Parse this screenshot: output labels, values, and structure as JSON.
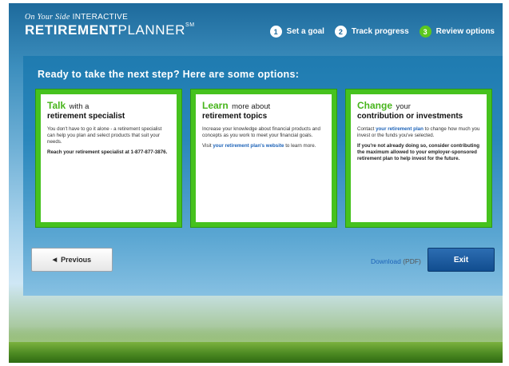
{
  "brand": {
    "tagline_italic": "On Your Side",
    "tagline_rest": "INTERACTIVE",
    "title_bold": "RETIREMENT",
    "title_thin": "PLANNER",
    "trademark": "SM"
  },
  "steps": [
    {
      "num": "1",
      "label": "Set a goal"
    },
    {
      "num": "2",
      "label": "Track progress"
    },
    {
      "num": "3",
      "label": "Review options"
    }
  ],
  "main": {
    "heading": "Ready to take the next step? Here are some options:",
    "cards": [
      {
        "accent": "Talk",
        "rest": "with a",
        "subtitle": "retirement specialist",
        "body": "You don't have to go it alone - a retirement specialist can help you plan and select products that suit your needs.",
        "bold_text": "Reach your retirement specialist at 1-877-877-3876."
      },
      {
        "accent": "Learn",
        "rest": "more about",
        "subtitle": "retirement topics",
        "body": "Increase your knowledge about financial products and concepts as you work to meet your financial goals.",
        "link_pre": "Visit",
        "link_text": "your retirement plan's website",
        "link_post": "to learn more."
      },
      {
        "accent": "Change",
        "rest": "your",
        "subtitle": "contribution or investments",
        "body_pre": "Contact",
        "link_text": "your retirement plan",
        "body_post": "to change how much you invest or the funds you've selected.",
        "bold_text": "If you're not already doing so, consider contributing the maximum allowed to your employer-sponsored retirement plan to help invest for the future."
      }
    ]
  },
  "footer": {
    "previous_label": "Previous",
    "download_label": "Download",
    "download_format": "(PDF)",
    "exit_label": "Exit"
  },
  "colors": {
    "accent_green": "#46c21e",
    "brand_blue": "#1d6a9c",
    "link_blue": "#1d63b8"
  }
}
